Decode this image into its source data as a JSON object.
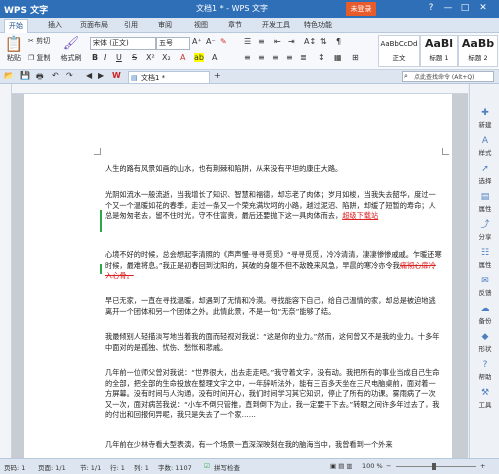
{
  "window": {
    "app_name": "WPS 文字",
    "title": "文档1 * - WPS 文字",
    "login_label": "未登录",
    "controls": [
      "?",
      "—",
      "□",
      "✕"
    ]
  },
  "ribbon_tabs": [
    "开始",
    "插入",
    "页面布局",
    "引用",
    "审阅",
    "视图",
    "章节",
    "开发工具",
    "特色功能"
  ],
  "ribbon": {
    "cut": "剪切",
    "copy": "复制",
    "format_painter": "格式刷",
    "paste": "粘贴",
    "font_name": "宋体 (正文)",
    "font_size": "五号",
    "bold": "B",
    "italic": "I",
    "underline": "U",
    "strike": "S",
    "styles": [
      {
        "sample": "AaBbCcDd",
        "name": "正文"
      },
      {
        "sample": "AaBl",
        "name": "标题 1"
      },
      {
        "sample": "AaBb",
        "name": "标题 2"
      }
    ],
    "new_style": "新样式",
    "text_tool": "文字工具",
    "find_replace": "查找替换",
    "select": "选择"
  },
  "doc_tabs": {
    "tab_label": "文档1 *",
    "search_placeholder": "点此查找命令 (Alt+Q)"
  },
  "document": {
    "paragraphs": [
      "人生的路有风景如画的山水，也有荆棘和陷阱，从来没有平坦的康庄大路。",
      "光阴如流水一般流逝，当我增长了知识、智慧和福德，却忘老了肉体；岁月如梭，当我失去韶华，度过一个又一个温暖如花的春季，走过一条又一个荣充满坎坷的小路，越过泥沼、陷阱，却缓了短暂的寿命；人总是匆匆老去，留不住时光，守不住富贵，最后还要抛下这一具肉体而去，",
      "心境不好的时候，总会想起李清照的《声声慢·寻寻觅觅》“寻寻觅觅，冷冷清清，凄凄惨惨戚戚。乍暖还寒时候，最难将息。”我正是初春回到沈阳的，其破的身躯不但不敌晚来风急，早晨的寒冷亦令我",
      "早已无家，一直在寻找温暖，却遇到了无情和冷漠。寻找能容下自己，给自己温情的家，却总是被迫地逃离开一个团体和另一个团体之外。此情此景，不是一句“无奈”能够了结。",
      "我最倾别人轻描淡写地当着我的面而轻视对我说：“这是你的业力。”然而，这何曾又不是我的业力。十多年中面对的是孤独、忧伤、愁怅和悲戚。",
      "几年前一位师父曾对我说：“世界很大，出去走走吧。”我守着文字，没有动。我把所有的事业当成自己生命的全部，把全部的生命投放在整理文字之中，一年辞听法外，能有三百多天坐在三尺电脑桌前，面对着一方屏幕。没有时间与人沟通，没有时间开心，我们时间学习其它知识，停止了所有的功课。雾雨病了一次又一次，面对病苦我说：“小车不倒只管推，直到倒下为止，我一定要干下去。”转眼之间许多年过去了，我的付出和回报何异呢，我只是失去了一个家……",
      "几年前在少林寺看大型表演，有一个场景一直深深映刻在我的脑海当中，我曾看到一个外来"
    ],
    "inserted_text": "超级下载站",
    "deleted_text": "痛彻心扉冷入心骨。"
  },
  "sidebar": [
    "新建",
    "样式",
    "选择",
    "属性",
    "分享",
    "属性",
    "反馈",
    "备份",
    "形状",
    "帮助",
    "工具"
  ],
  "statusbar": {
    "page": "页码: 1",
    "pages": "页面: 1/1",
    "section": "节: 1/1",
    "row": "行: 1",
    "column": "列: 1",
    "word_count": "字数: 1107",
    "spell_check": "拼写检查",
    "zoom": "100 %"
  }
}
